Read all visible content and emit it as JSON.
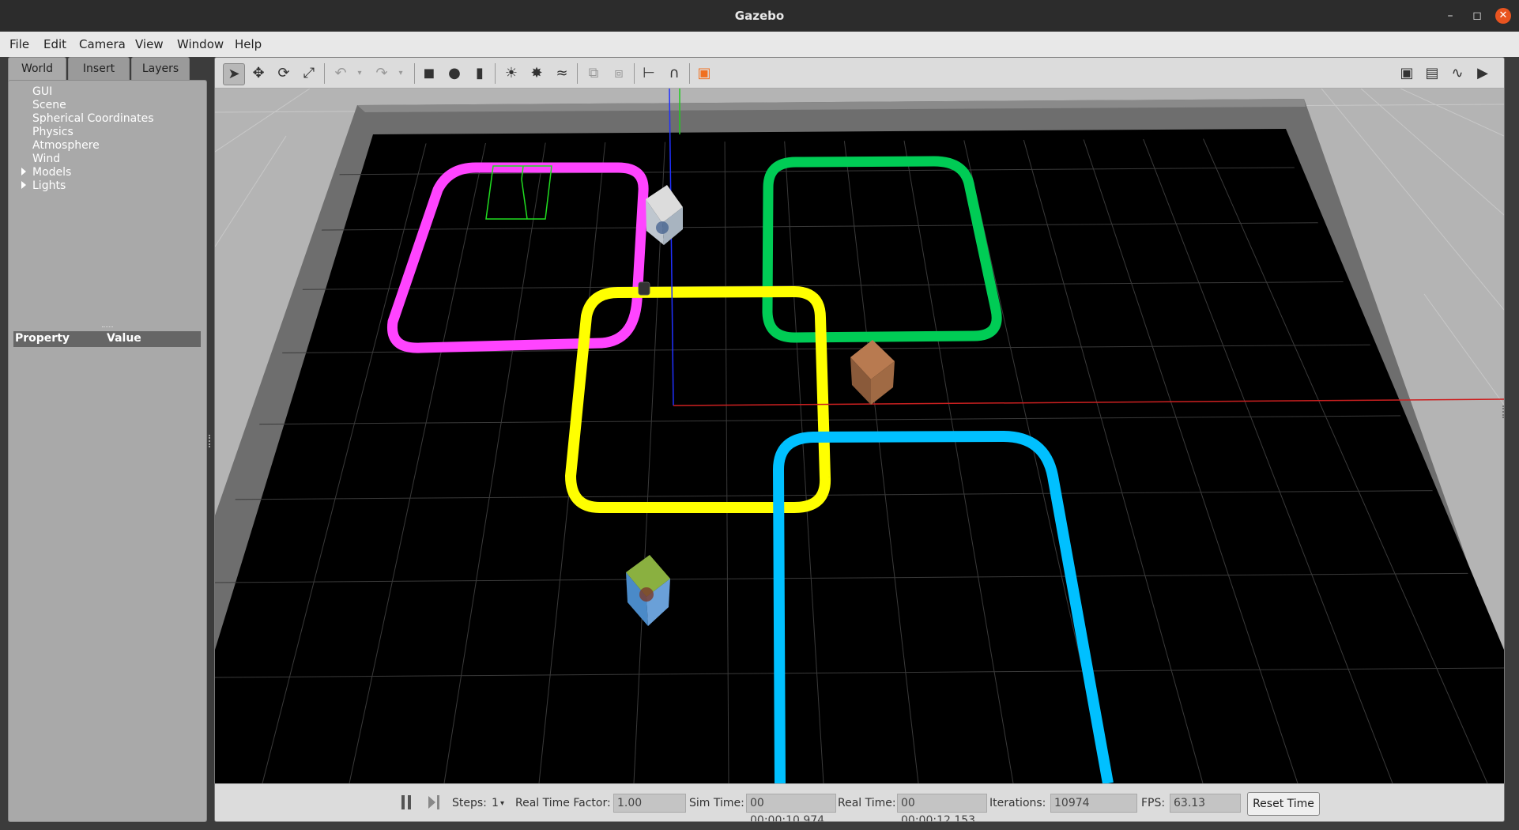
{
  "window": {
    "title": "Gazebo",
    "minimize_icon": "minimize-icon",
    "restore_icon": "restore-icon",
    "close_icon": "close-icon",
    "close_color": "#e95420"
  },
  "menu": [
    "File",
    "Edit",
    "Camera",
    "View",
    "Window",
    "Help"
  ],
  "left_panel": {
    "tabs": [
      "World",
      "Insert",
      "Layers"
    ],
    "active_tab": "World",
    "tree": [
      "GUI",
      "Scene",
      "Spherical Coordinates",
      "Physics",
      "Atmosphere",
      "Wind",
      "Models",
      "Lights"
    ],
    "expandable": [
      "Models",
      "Lights"
    ],
    "property_header": {
      "property": "Property",
      "value": "Value"
    }
  },
  "toolbar": {
    "left_tools": [
      "select-arrow-icon",
      "translate-icon",
      "rotate-icon",
      "scale-icon",
      "undo-icon",
      "undo-dropdown-icon",
      "redo-icon",
      "redo-dropdown-icon",
      "box-icon",
      "sphere-icon",
      "cylinder-icon",
      "point-light-icon",
      "spot-light-icon",
      "directional-light-icon",
      "copy-icon",
      "paste-icon",
      "align-icon",
      "snap-icon",
      "view-angle-icon"
    ],
    "right_tools": [
      "screenshot-icon",
      "log-icon",
      "plot-icon",
      "record-video-icon"
    ]
  },
  "scene": {
    "tracks": [
      {
        "color": "#ff44ff",
        "name": "magenta"
      },
      {
        "color": "#00cc55",
        "name": "green"
      },
      {
        "color": "#ffff00",
        "name": "yellow"
      },
      {
        "color": "#00c0ff",
        "name": "cyan"
      }
    ],
    "floor_color": "#000000",
    "wall_color": "#6e6e6e",
    "ground_color": "#b4b4b4"
  },
  "status": {
    "pause_icon": "pause-icon",
    "step_icon": "step-icon",
    "steps_label": "Steps:",
    "steps_value": "1",
    "rtf_label": "Real Time Factor:",
    "rtf_value": "1.00",
    "sim_time_label": "Sim Time:",
    "sim_time_value": "00 00:00:10.974",
    "real_time_label": "Real Time:",
    "real_time_value": "00 00:00:12.153",
    "iterations_label": "Iterations:",
    "iterations_value": "10974",
    "fps_label": "FPS:",
    "fps_value": "63.13",
    "reset_label": "Reset Time"
  }
}
